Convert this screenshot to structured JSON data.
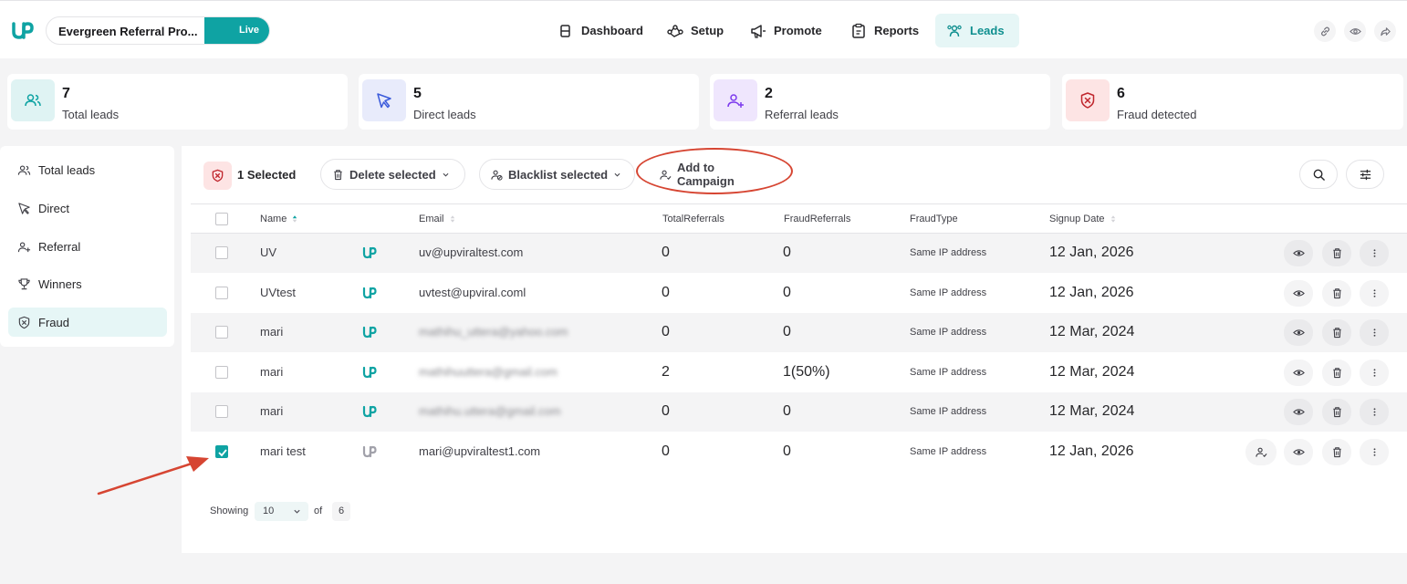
{
  "header": {
    "campaign_name": "Evergreen Referral Pro...",
    "status": "Live",
    "nav": [
      {
        "label": "Dashboard",
        "icon": "dashboard-icon"
      },
      {
        "label": "Setup",
        "icon": "setup-icon"
      },
      {
        "label": "Promote",
        "icon": "megaphone-icon"
      },
      {
        "label": "Reports",
        "icon": "clipboard-icon"
      },
      {
        "label": "Leads",
        "icon": "users-icon",
        "active": true
      }
    ],
    "right_icons": [
      "link-icon",
      "eye-icon",
      "share-icon"
    ]
  },
  "stats": [
    {
      "value": "7",
      "label": "Total leads",
      "icon": "users-icon",
      "color": "#0fa3a3"
    },
    {
      "value": "5",
      "label": "Direct leads",
      "icon": "cursor-icon",
      "color": "#3b5bdb"
    },
    {
      "value": "2",
      "label": "Referral leads",
      "icon": "user-plus-icon",
      "color": "#7c3aed"
    },
    {
      "value": "6",
      "label": "Fraud detected",
      "icon": "shield-x-icon",
      "color": "#c0262d"
    }
  ],
  "sidebar": {
    "items": [
      {
        "label": "Total leads",
        "icon": "users-icon"
      },
      {
        "label": "Direct",
        "icon": "cursor-icon"
      },
      {
        "label": "Referral",
        "icon": "user-plus-icon"
      },
      {
        "label": "Winners",
        "icon": "trophy-icon"
      },
      {
        "label": "Fraud",
        "icon": "shield-icon",
        "active": true
      }
    ]
  },
  "toolbar": {
    "selected_label": "1 Selected",
    "delete_label": "Delete selected",
    "blacklist_label": "Blacklist selected",
    "add_label": "Add to Campaign"
  },
  "table": {
    "columns": [
      "Name",
      "Email",
      "TotalReferrals",
      "FraudReferrals",
      "FraudType",
      "Signup Date"
    ],
    "rows": [
      {
        "name": "UV",
        "email": "uv@upviraltest.com",
        "total": "0",
        "fraud": "0",
        "type": "Same IP address",
        "date": "12 Jan, 2026",
        "checked": false,
        "blurred": false
      },
      {
        "name": "UVtest",
        "email": "uvtest@upviral.coml",
        "total": "0",
        "fraud": "0",
        "type": "Same IP address",
        "date": "12 Jan, 2026",
        "checked": false,
        "blurred": false
      },
      {
        "name": "mari",
        "email": "mathihu_uttera@yahoo.com",
        "total": "0",
        "fraud": "0",
        "type": "Same IP address",
        "date": "12 Mar, 2024",
        "checked": false,
        "blurred": true
      },
      {
        "name": "mari",
        "email": "mathihuuttera@gmail.com",
        "total": "2",
        "fraud": "1(50%)",
        "type": "Same IP address",
        "date": "12 Mar, 2024",
        "checked": false,
        "blurred": true
      },
      {
        "name": "mari",
        "email": "mathihu.uttera@gmail.com",
        "total": "0",
        "fraud": "0",
        "type": "Same IP address",
        "date": "12 Mar, 2024",
        "checked": false,
        "blurred": true
      },
      {
        "name": "mari test",
        "email": "mari@upviraltest1.com",
        "total": "0",
        "fraud": "0",
        "type": "Same IP address",
        "date": "12 Jan, 2026",
        "checked": true,
        "blurred": false
      }
    ]
  },
  "footer": {
    "showing_label": "Showing",
    "page_size": "10",
    "of_label": "of",
    "total": "6"
  },
  "colors": {
    "accent": "#0fa3a3",
    "annotation": "#d64532"
  }
}
